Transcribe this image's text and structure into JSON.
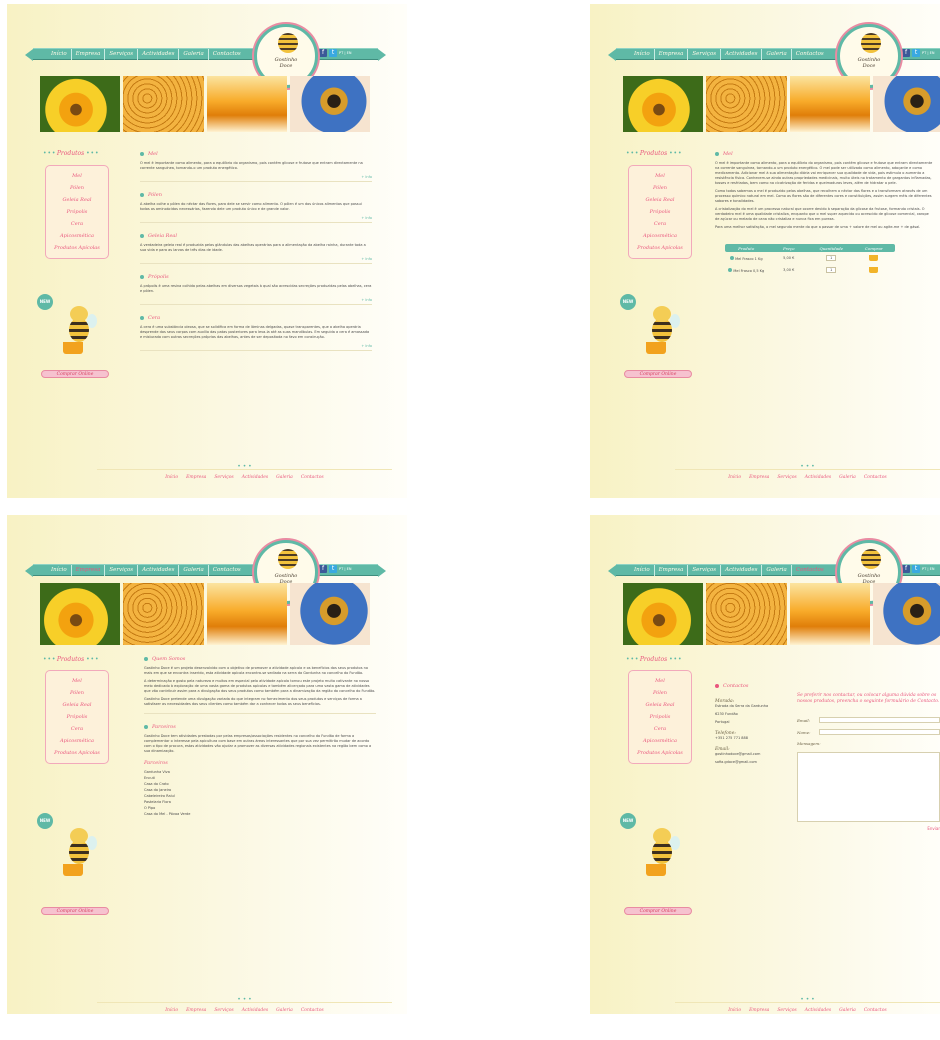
{
  "nav": [
    "Início",
    "Empresa",
    "Serviços",
    "Actividades",
    "Galeria",
    "Contactos"
  ],
  "brand": {
    "line1": "Gostinho",
    "line2": "Doce"
  },
  "social": {
    "fb": "f",
    "tw": "t",
    "label": "PT | EN"
  },
  "side": {
    "title": "Produtos",
    "items": [
      "Mel",
      "Pólen",
      "Geleia Real",
      "Própolis",
      "Cera",
      "Apicosmética",
      "Produtos Apícolas"
    ],
    "new_badge": "NEW",
    "shop_button": "Comprar Online"
  },
  "page1": {
    "sections": [
      {
        "title": "Mel",
        "text": "O mel é importante como alimento, para o equilíbrio do organismo, pois contém glicose e frutose que entram directamente na corrente sanguínea, tornando-o um produto energético.",
        "more": "+ Info"
      },
      {
        "title": "Pólen",
        "text": "A abelha colhe o pólen do néctar das flores, para dele se servir como alimento. O pólen é um dos únicos alimentos que possui todos os aminoácidos necessários, fazendo dele um produto único e de grande valor.",
        "more": "+ Info"
      },
      {
        "title": "Geleia Real",
        "text": "A verdadeira geleia real é produzida pelas glândulas das abelhas operárias para a alimentação da abelha rainha, durante toda a sua vida e para as larvas de três dias de idade.",
        "more": "+ Info"
      },
      {
        "title": "Própolis",
        "text": "A própolis é uma resina colhida pelas abelhas em diversos vegetais à qual são acrescidas secreções produzidas pelas abelhas, cera e pólen.",
        "more": "+ Info"
      },
      {
        "title": "Cera",
        "text": "A cera é uma substância oleosa, que se solidifica em forma de lâminas delgadas, quase transparentes, que a abelha operária desprende dos seus corpos com auxílio das patas posteriores para leva-la até as suas mandíbulas. Em seguida a cera é amassada e misturada com outras secreções próprias das abelhas, antes de ser depositada no favo em construção.",
        "more": "+ Info"
      }
    ]
  },
  "page2": {
    "title": "Mel",
    "paragraphs": [
      "O mel é importante como alimento, para o equilíbrio do organismo, pois contém glicose e frutose que entram directamente na corrente sanguínea, tornando-o um produto energético. O mel pode ser utilizado como alimento, adoçante e como medicamento. Adicionar mel à sua alimentação diária vai enriquecer sua qualidade de vida, pois estimula o aumento a resistência física. Conhecem-se ainda outras propriedades medicinais, muito úteis no tratamento de gargantas inflamadas, tosses e resfriados, bem como na cicatrização de feridas e queimaduras leves, além de hidratar a pele.",
      "Como todos sabemos o mel é produzido pelas abelhas, que recolhem o néctar das flores e o transformam através de um processo químico natural em mel. Como as flores são de diferentes cores e constituições, assim surgem méis de diferentes sabores e tonalidades.",
      "A cristalização do mel é um processo natural que ocorre devido à separação da glicose da frutose, formando cristais. O verdadeiro mel é uma qualidade cristaliza, enquanto que o mel super aquecido ou acrescido de glicose comercial, xarope de açúcar ou melado de cana não cristaliza e nunca fica em pureza.",
      "Para uma melhor satisfação, o mel segunda mente do que a passar de uma + valore de mel ou agite-me + de gásal."
    ],
    "table": {
      "headers": [
        "Produto",
        "Preço",
        "Quantidade",
        "Comprar"
      ],
      "rows": [
        {
          "name": "Mel Frasco 1 Kg",
          "price": "5,00 €",
          "qty": "1"
        },
        {
          "name": "Mel Frasco 0,5 Kg",
          "price": "3,00 €",
          "qty": "1"
        }
      ]
    }
  },
  "page3": {
    "about_title": "Quem Somos",
    "about_paragraphs": [
      "Gostinho Doce é um projeto desenvolvido com o objetivo de promover a atividade apícola e os benefícios dos seus produtos no mais em que se encontra inserido, esta atividade apícola encontra-se sediada na serra da Gardunha no concelho do Fundão.",
      "A determinação e gosto pela natureza e muitos em especial pelo atividade apícola tornou este projeto muito cativante no nosso meio dedicado à exploração de uma vasta gama de produtos apícolas e também alicerçado para uma vasta gama de atividades que vão contribuir assim para a divulgação dos seus produtos como também para a dinamização da região do concelho do Fundão.",
      "Gostinho Doce pretende uma divulgação variada do que integram no fornecimento dos seus produtos e serviços de forma a satisfazer as necessidades dos seus clientes como também dar a conhecer todos os seus benefícios."
    ],
    "partners_title": "Parceiros",
    "partners_text": "Gostinho Doce tem atividades prestadas por pelas empresas/associações residentes no concelho do Fundão de forma a complementar o interesse pela apicultura com base em outras áreas interessantes que por sua vez permitirão mudar de acordo com o tipo de procura, estas atividades vão ajudar a promover as diversas atividades regionais existentes na região bem como a sua dinamização.",
    "list_title": "Parceiros",
    "list": [
      "Gardunha Viva",
      "Encuti",
      "Casa do Crato",
      "Casa do Janeiro",
      "Cabeleireiro Raiul",
      "Pastelaria Flora",
      "O Pipo",
      "Casa do Mel - Póvoa Verde"
    ]
  },
  "page4": {
    "title": "Contactos",
    "morada_label": "Morada:",
    "morada": [
      "Estrada da Serra da Gardunha",
      "6230 Fundão",
      "Portugal"
    ],
    "phone_label": "Telefone:",
    "phone": "+351 275 771 888",
    "email_label": "Email:",
    "emails": [
      "gostinhodoce@gmail.com",
      "sofia.gdoce@gmail.com"
    ],
    "intro": "Se preferir nos contactar, ou colocar alguma dúvida sobre os nossos produtos, preencha o seguinte formulário de Contacto.",
    "field_email": "Email:",
    "field_name": "Nome:",
    "field_msg": "Mensagem:",
    "send": "Enviar"
  }
}
